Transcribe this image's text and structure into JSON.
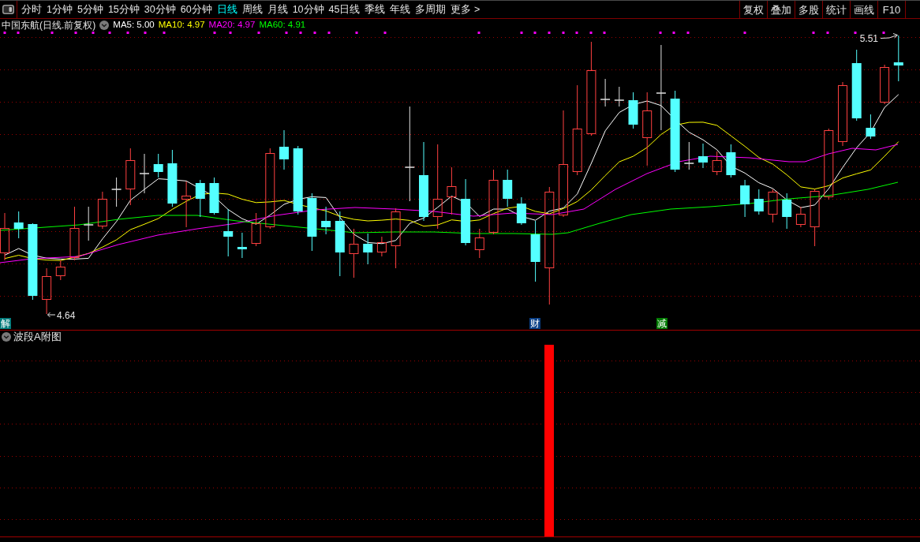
{
  "tabs": [
    {
      "label": "分时",
      "selected": false
    },
    {
      "label": "1分钟",
      "selected": false
    },
    {
      "label": "5分钟",
      "selected": false
    },
    {
      "label": "15分钟",
      "selected": false
    },
    {
      "label": "30分钟",
      "selected": false
    },
    {
      "label": "60分钟",
      "selected": false
    },
    {
      "label": "日线",
      "selected": true
    },
    {
      "label": "周线",
      "selected": false
    },
    {
      "label": "月线",
      "selected": false
    },
    {
      "label": "10分钟",
      "selected": false
    },
    {
      "label": "45日线",
      "selected": false
    },
    {
      "label": "季线",
      "selected": false
    },
    {
      "label": "年线",
      "selected": false
    },
    {
      "label": "多周期",
      "selected": false
    },
    {
      "label": "更多 >",
      "selected": false
    }
  ],
  "tools": [
    "复权",
    "叠加",
    "多股",
    "统计",
    "画线",
    "F10"
  ],
  "legend": {
    "title": "中国东航(日线.前复权)",
    "averages": [
      {
        "label": "MA5: 5.00",
        "color": "#ffffff"
      },
      {
        "label": "MA10: 4.97",
        "color": "#ffff00"
      },
      {
        "label": "MA20: 4.97",
        "color": "#ff00ff"
      },
      {
        "label": "MA60: 4.91",
        "color": "#00ff00"
      }
    ]
  },
  "main_chart": {
    "high_label": "5.51",
    "low_label": "4.64",
    "markers": [
      {
        "text": "解",
        "color": "#007b7b"
      },
      {
        "text": "财",
        "color": "#0a3f86"
      },
      {
        "text": "减",
        "color": "#007a00"
      }
    ]
  },
  "sub_chart": {
    "title": "波段A附图"
  }
}
